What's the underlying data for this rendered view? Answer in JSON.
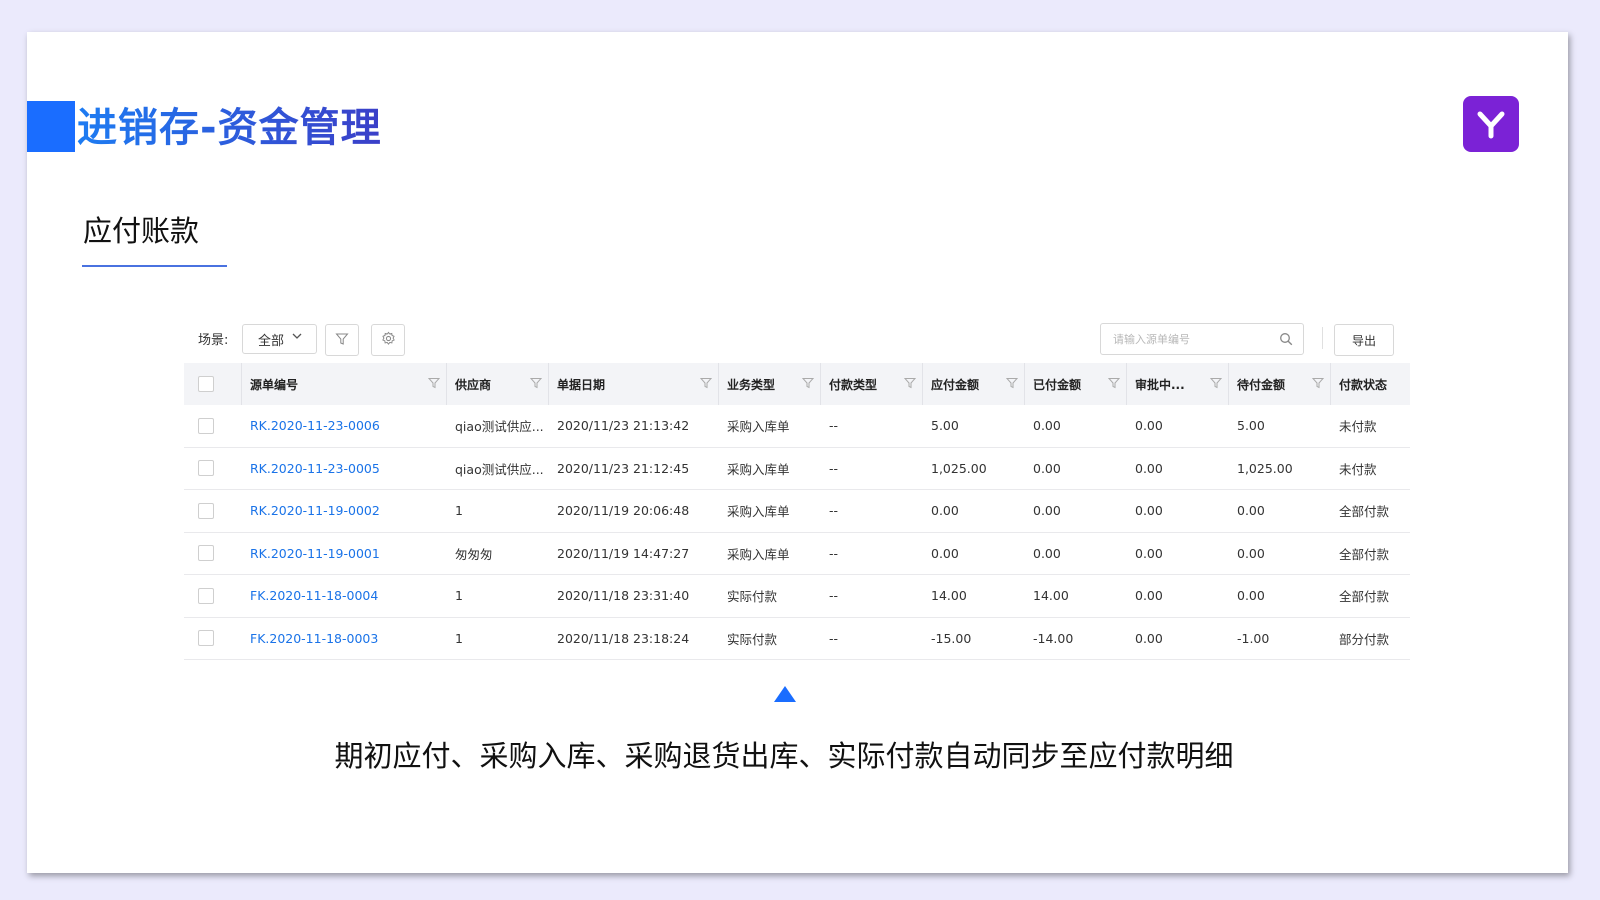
{
  "header": {
    "title": "进销存-资金管理"
  },
  "section": {
    "title": "应付账款"
  },
  "toolbar": {
    "scene_label": "场景:",
    "scene_value": "全部",
    "search_placeholder": "请输入源单编号",
    "export_label": "导出"
  },
  "table": {
    "columns": [
      "源单编号",
      "供应商",
      "单据日期",
      "业务类型",
      "付款类型",
      "应付金额",
      "已付金额",
      "审批中...",
      "待付金额",
      "付款状态"
    ],
    "rows": [
      [
        "RK.2020-11-23-0006",
        "qiao测试供应...",
        "2020/11/23 21:13:42",
        "采购入库单",
        "--",
        "5.00",
        "0.00",
        "0.00",
        "5.00",
        "未付款"
      ],
      [
        "RK.2020-11-23-0005",
        "qiao测试供应...",
        "2020/11/23 21:12:45",
        "采购入库单",
        "--",
        "1,025.00",
        "0.00",
        "0.00",
        "1,025.00",
        "未付款"
      ],
      [
        "RK.2020-11-19-0002",
        "1",
        "2020/11/19 20:06:48",
        "采购入库单",
        "--",
        "0.00",
        "0.00",
        "0.00",
        "0.00",
        "全部付款"
      ],
      [
        "RK.2020-11-19-0001",
        "匆匆匆",
        "2020/11/19 14:47:27",
        "采购入库单",
        "--",
        "0.00",
        "0.00",
        "0.00",
        "0.00",
        "全部付款"
      ],
      [
        "FK.2020-11-18-0004",
        "1",
        "2020/11/18 23:31:40",
        "实际付款",
        "--",
        "14.00",
        "14.00",
        "0.00",
        "0.00",
        "全部付款"
      ],
      [
        "FK.2020-11-18-0003",
        "1",
        "2020/11/18 23:18:24",
        "实际付款",
        "--",
        "-15.00",
        "-14.00",
        "0.00",
        "-1.00",
        "部分付款"
      ]
    ]
  },
  "caption": "期初应付、采购入库、采购退货出库、实际付款自动同步至应付款明细",
  "colors": {
    "accent": "#1a6dff",
    "link": "#1a73e8",
    "logo": "#7b22d6",
    "background": "#ebeafc"
  }
}
